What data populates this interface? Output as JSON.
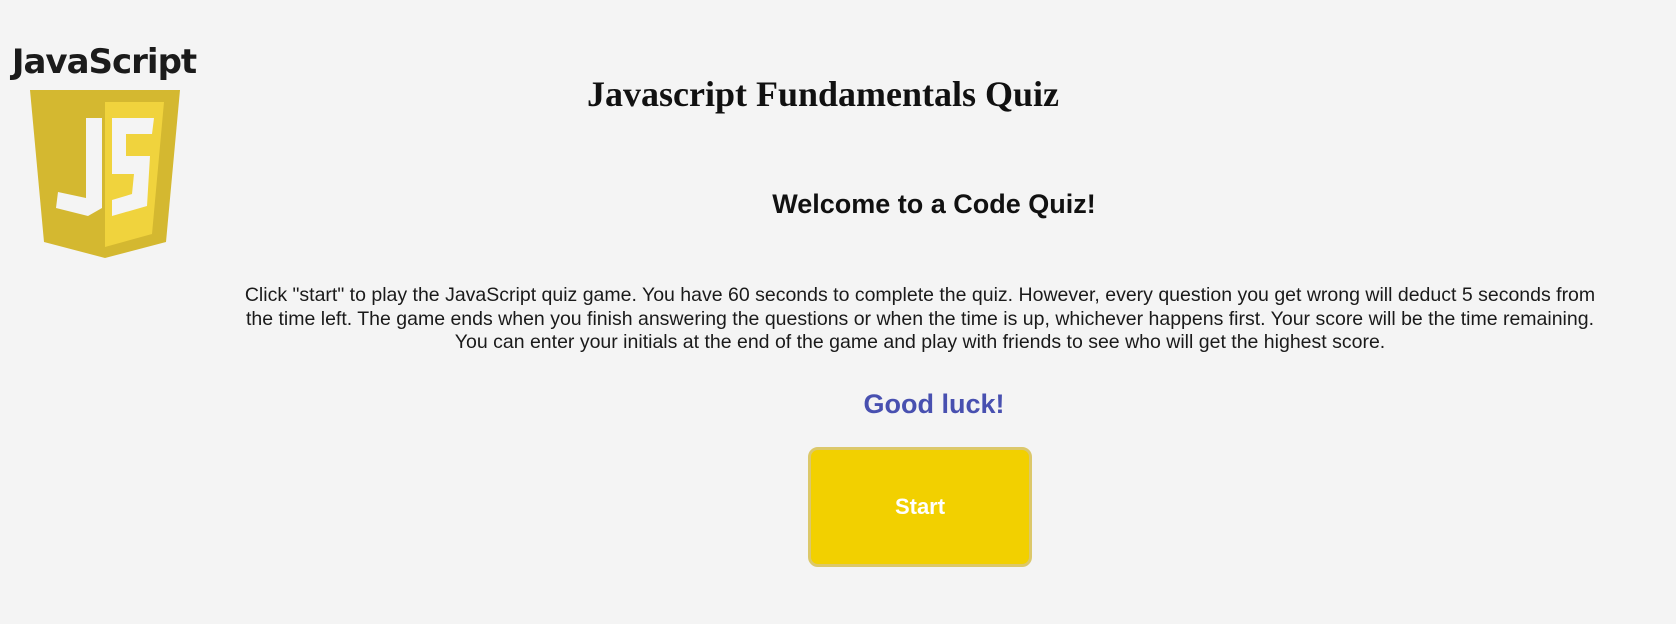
{
  "logo": {
    "wordmark": "JavaScript",
    "monogram": "JS",
    "colors": {
      "shield_dark": "#d4b830",
      "shield_light": "#f0d33d",
      "letters": "#f4f4f4"
    }
  },
  "header": {
    "title": "Javascript Fundamentals Quiz"
  },
  "intro": {
    "welcome": "Welcome to a Code Quiz!",
    "instructions": "Click \"start\" to play the JavaScript quiz game. You have 60 seconds to complete the quiz. However, every question you get wrong will deduct 5 seconds from the time left. The game ends when you finish answering the questions or when the time is up, whichever happens first. Your score will be the time remaining. You can enter your initials at the end of the game and play with friends to see who will get the highest score.",
    "good_luck": "Good luck!",
    "good_luck_color": "#4850b0"
  },
  "actions": {
    "start_label": "Start",
    "start_color": "#f2d000"
  }
}
